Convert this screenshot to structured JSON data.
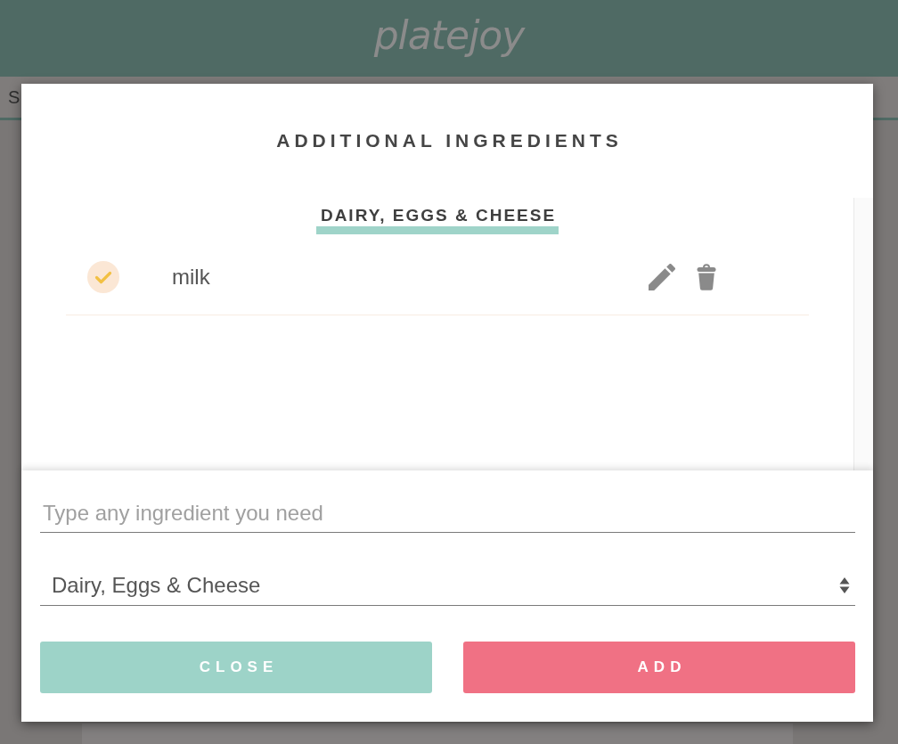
{
  "header": {
    "logo": "platejoy"
  },
  "nav": {
    "tab_label": "S"
  },
  "modal": {
    "title": "ADDITIONAL INGREDIENTS",
    "sections": [
      {
        "heading": "DAIRY, EGGS & CHEESE",
        "items": [
          {
            "name": "milk",
            "checked": true
          }
        ]
      }
    ],
    "ingredient_input": {
      "placeholder": "Type any ingredient you need"
    },
    "category_select": {
      "value": "Dairy, Eggs & Cheese"
    },
    "buttons": [
      {
        "label": "CLOSE",
        "kind": "close"
      },
      {
        "label": "ADD",
        "kind": "add"
      }
    ]
  }
}
